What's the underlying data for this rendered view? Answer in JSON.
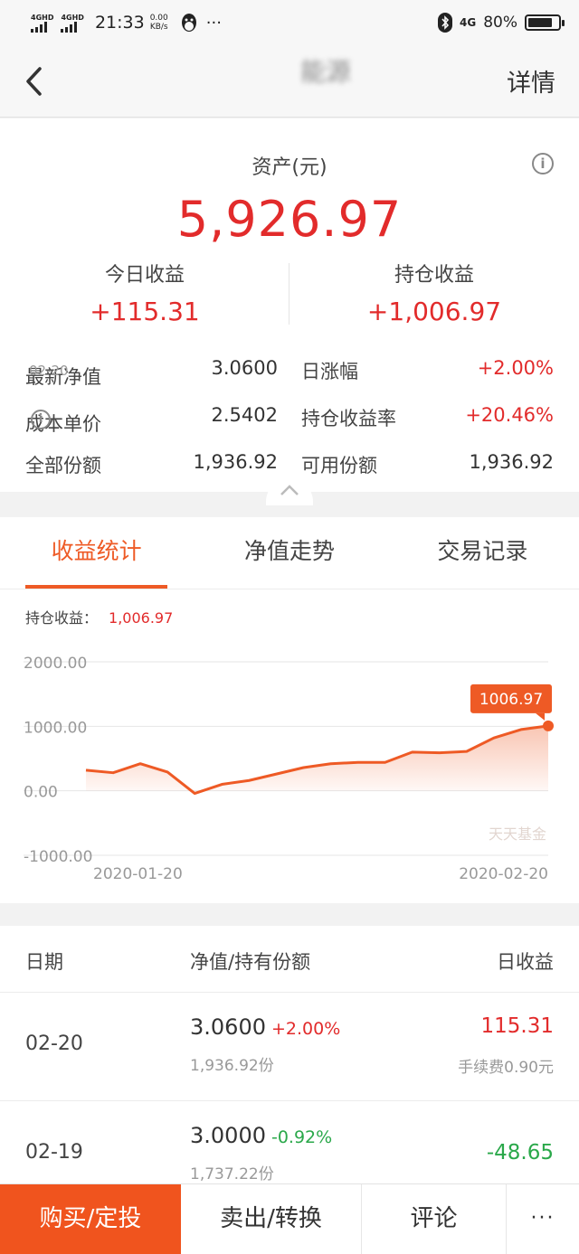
{
  "status_bar": {
    "net1": "4GHD",
    "net2": "4GHD",
    "time": "21:33",
    "speed_value": "0.00",
    "speed_unit": "KB/s",
    "more": "···",
    "net3": "4G",
    "battery": "80%",
    "battery_level": 0.8
  },
  "nav": {
    "title": "能源",
    "detail": "详情"
  },
  "assets": {
    "label": "资产(元)",
    "value": "5,926.97",
    "today_label": "今日收益",
    "today_value": "+115.31",
    "hold_label": "持仓收益",
    "hold_value": "+1,006.97"
  },
  "metrics": [
    {
      "left_label": "最新净值",
      "left_date": "02-20",
      "left_value": "3.0600",
      "right_label": "日涨幅",
      "right_value": "+2.00%"
    },
    {
      "left_label": "成本单价",
      "left_value": "2.5402",
      "right_label": "持仓收益率",
      "right_value": "+20.46%"
    },
    {
      "left_label": "全部份额",
      "left_value": "1,936.92",
      "right_label": "可用份额",
      "right_value": "1,936.92"
    }
  ],
  "tabs": [
    "收益统计",
    "净值走势",
    "交易记录"
  ],
  "hold_line": {
    "label": "持仓收益：",
    "value": "1,006.97"
  },
  "chart_data": {
    "type": "area",
    "x": [
      "2020-01-20",
      "2020-01-21",
      "2020-01-22",
      "2020-01-23",
      "2020-02-03",
      "2020-02-04",
      "2020-02-05",
      "2020-02-06",
      "2020-02-07",
      "2020-02-10",
      "2020-02-11",
      "2020-02-12",
      "2020-02-13",
      "2020-02-14",
      "2020-02-17",
      "2020-02-18",
      "2020-02-19",
      "2020-02-20"
    ],
    "values": [
      320,
      280,
      420,
      290,
      -40,
      100,
      160,
      260,
      360,
      420,
      440,
      440,
      600,
      590,
      610,
      820,
      950,
      1006.97
    ],
    "ylim": [
      -1000,
      2000
    ],
    "yticks": [
      "2000.00",
      "1000.00",
      "0.00",
      "-1000.00"
    ],
    "yticks_values": [
      2000,
      1000,
      0,
      -1000
    ],
    "xtick_labels": [
      "2020-01-20",
      "2020-02-20"
    ],
    "last_label": "1006.97",
    "watermark": "天天基金",
    "color": "#ee5a25",
    "grid": true
  },
  "table": {
    "headers": [
      "日期",
      "净值/持有份额",
      "日收益"
    ],
    "rows": [
      {
        "date": "02-20",
        "nav": "3.0600",
        "change": "+2.00%",
        "shares": "1,936.92份",
        "income": "115.31",
        "fee": "手续费0.90元",
        "dir": "up"
      },
      {
        "date": "02-19",
        "nav": "3.0000",
        "change": "-0.92%",
        "shares": "1,737.22份",
        "income": "-48.65",
        "fee": "",
        "dir": "down"
      }
    ]
  },
  "bottom_bar": {
    "buy": "购买/定投",
    "sell": "卖出/转换",
    "comment": "评论",
    "more": "···"
  },
  "colors": {
    "accent": "#ee5a25",
    "up": "#e22b2b",
    "down": "#2aa84a"
  }
}
